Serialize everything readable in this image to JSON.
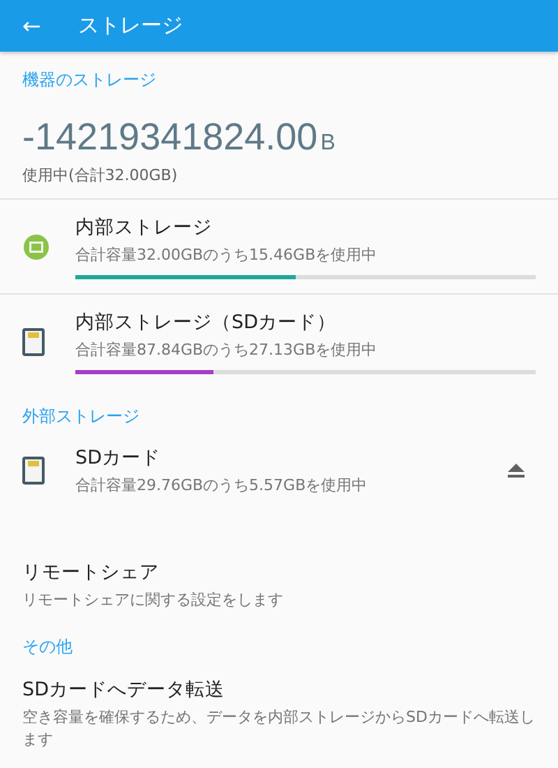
{
  "app_bar": {
    "back": "←",
    "title": "ストレージ"
  },
  "device_section": {
    "header": "機器のストレージ",
    "used_value": "-14219341824.00",
    "used_unit": "B",
    "used_caption": "使用中(合計32.00GB)",
    "volumes": [
      {
        "kind": "chip",
        "name": "内部ストレージ",
        "summary": "合計容量32.00GBのうち15.46GBを使用中",
        "level": 0.48,
        "color": "#1fa89a"
      },
      {
        "kind": "sdcard",
        "name": "内部ストレージ（SDカード）",
        "summary": "合計容量87.84GBのうち27.13GBを使用中",
        "level": 0.3,
        "color": "#a63fc6"
      }
    ]
  },
  "external_section": {
    "header": "外部ストレージ",
    "volumes": [
      {
        "kind": "sdcard",
        "name": "SDカード",
        "summary": "合計容量29.76GBのうち5.57GBを使用中",
        "ejectable": true
      }
    ]
  },
  "remote_share": {
    "title": "リモートシェア",
    "summary": "リモートシェアに関する設定をします"
  },
  "other_section": {
    "header": "その他",
    "items": [
      {
        "title": "SDカードへデータ転送",
        "summary": "空き容量を確保するため、データを内部ストレージからSDカードへ転送します"
      }
    ]
  }
}
